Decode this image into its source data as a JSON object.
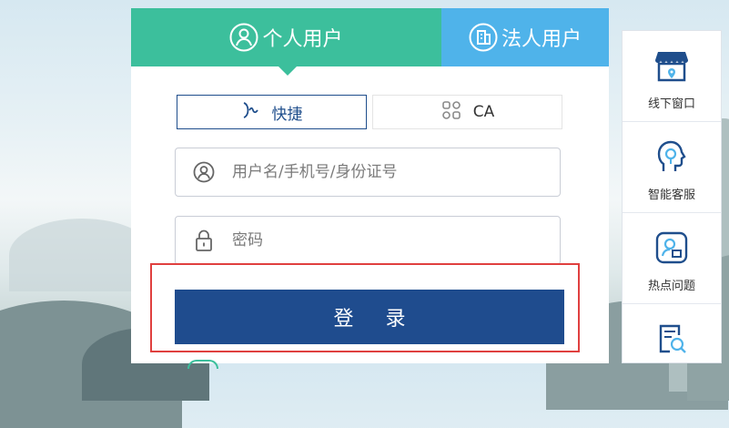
{
  "tabs": [
    {
      "label": "个人用户",
      "icon": "user-circle-icon",
      "active": true,
      "color": "#3cbf9c"
    },
    {
      "label": "法人用户",
      "icon": "building-icon",
      "active": false,
      "color": "#4fb3ea"
    }
  ],
  "login_modes": {
    "quick": {
      "label": "快捷",
      "icon": "quick-wave-icon",
      "active": true
    },
    "ca": {
      "label": "CA",
      "icon": "ca-grid-icon",
      "active": false
    }
  },
  "form": {
    "username_placeholder": "用户名/手机号/身份证号",
    "password_placeholder": "密码",
    "login_label": "登 录"
  },
  "sidebar": {
    "items": [
      {
        "label": "线下窗口",
        "icon": "store-icon"
      },
      {
        "label": "智能客服",
        "icon": "smart-service-icon"
      },
      {
        "label": "热点问题",
        "icon": "hot-question-icon"
      },
      {
        "label": "",
        "icon": "search-document-icon"
      }
    ]
  },
  "colors": {
    "primary": "#1f4c8e",
    "personal_tab": "#3cbf9c",
    "legal_tab": "#4fb3ea",
    "highlight": "#e0403f"
  }
}
